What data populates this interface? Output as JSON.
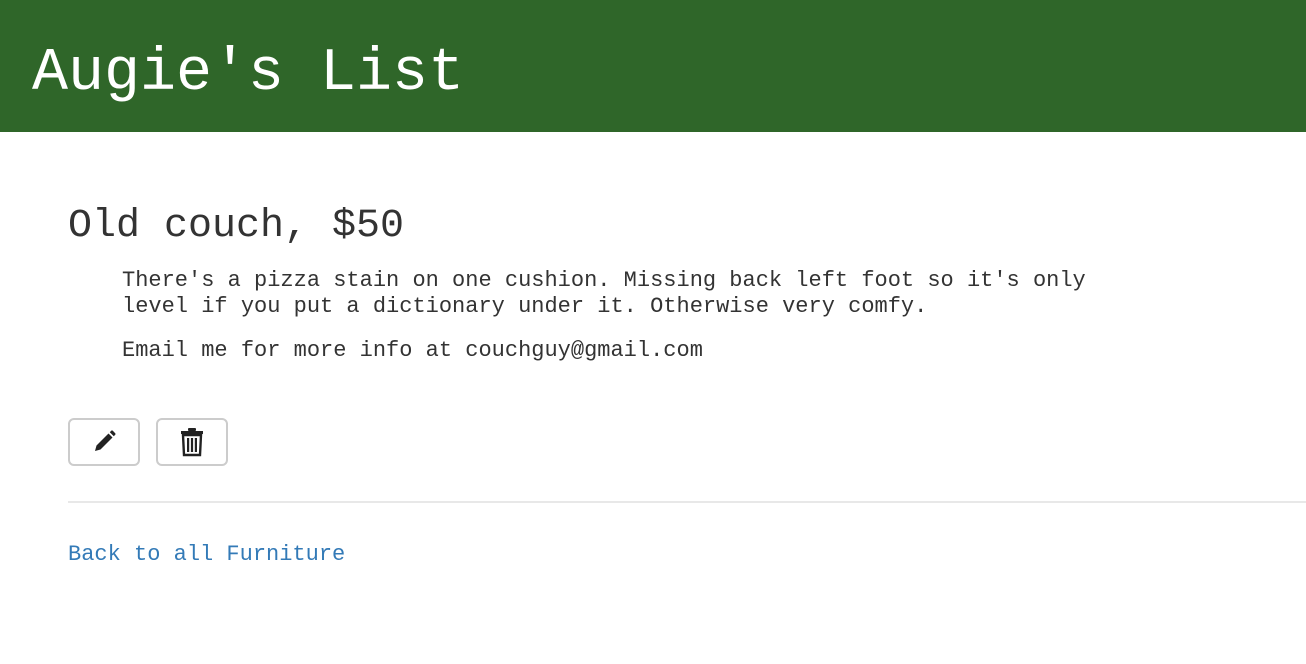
{
  "header": {
    "site_title": "Augie's List",
    "background_color": "#2f6629"
  },
  "listing": {
    "title": "Old couch, $50",
    "description": "There's a pizza stain on one cushion. Missing back left foot so it's only\nlevel if you put a dictionary under it. Otherwise very comfy.",
    "contact": "Email me for more info at couchguy@gmail.com"
  },
  "actions": {
    "edit_icon": "pencil-icon",
    "delete_icon": "trash-icon"
  },
  "footer": {
    "back_link": "Back to all Furniture",
    "link_color": "#337ab7"
  }
}
